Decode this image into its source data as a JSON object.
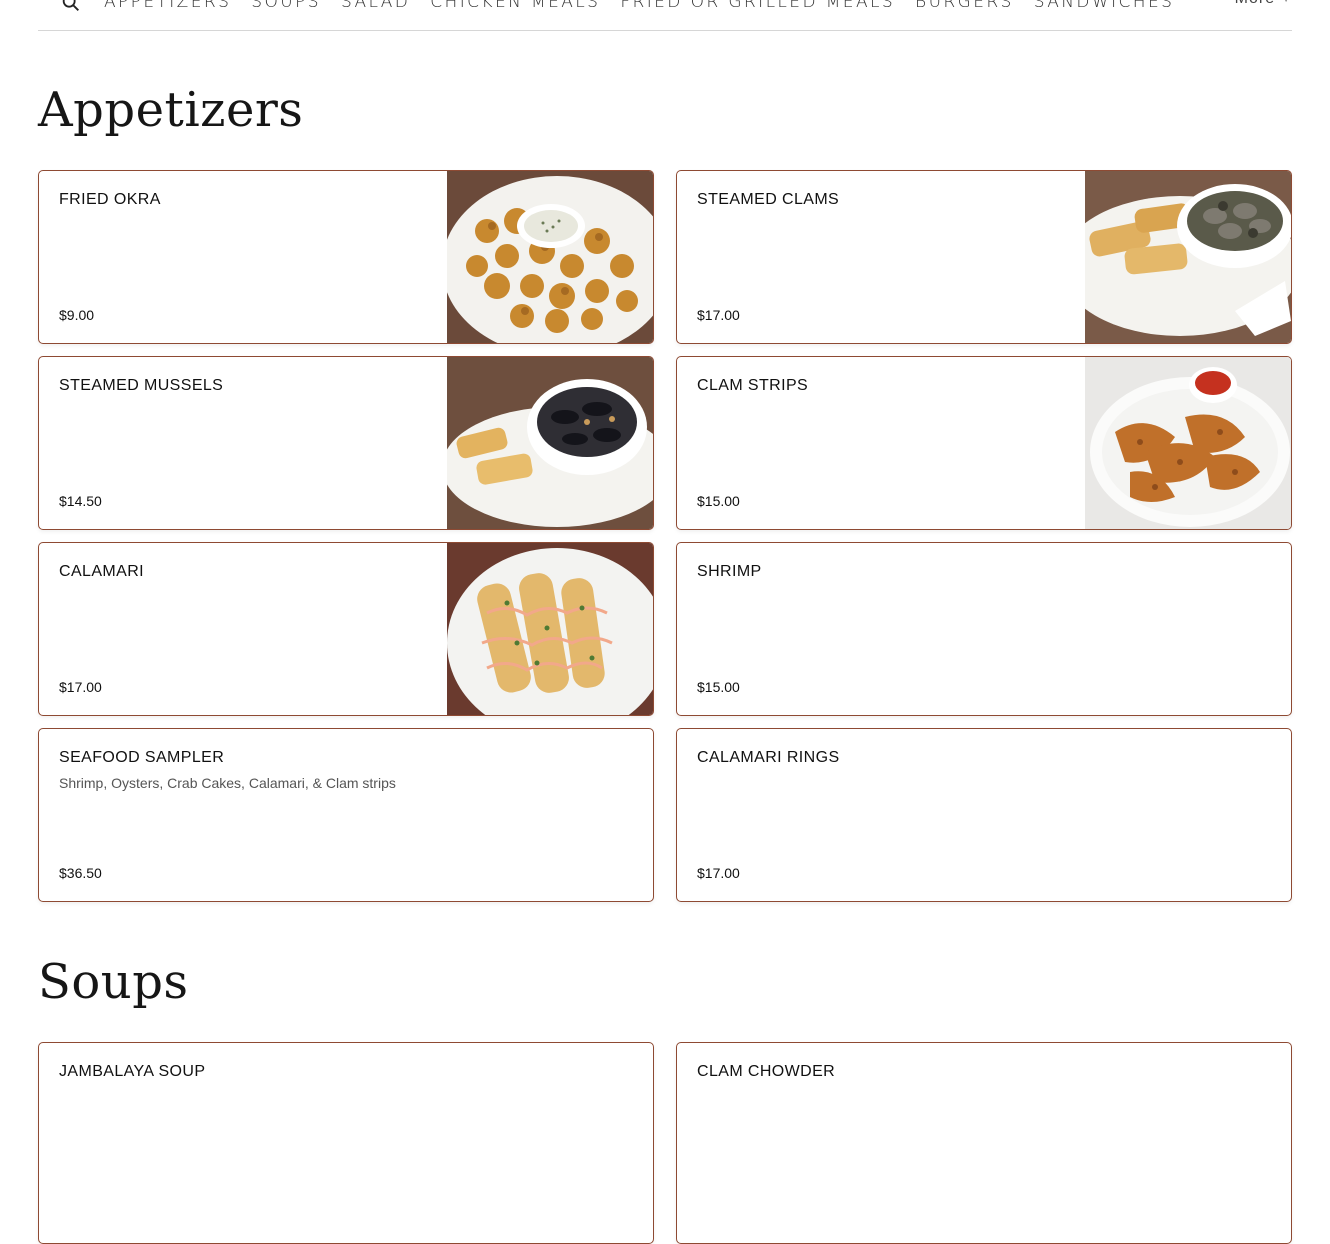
{
  "nav": {
    "items": [
      "Appetizers",
      "Soups",
      "Salad",
      "Chicken Meals",
      "Fried or Grilled Meals",
      "Burgers",
      "Sandwiches"
    ],
    "more_label": "More"
  },
  "sections": [
    {
      "title": "Appetizers",
      "items": [
        {
          "name": "FRIED OKRA",
          "price": "$9.00",
          "photo": "fried-okra-photo"
        },
        {
          "name": "STEAMED CLAMS",
          "price": "$17.00",
          "photo": "steamed-clams-photo"
        },
        {
          "name": "STEAMED MUSSELS",
          "price": "$14.50",
          "photo": "steamed-mussels-photo"
        },
        {
          "name": "CLAM STRIPS",
          "price": "$15.00",
          "photo": "clam-strips-photo"
        },
        {
          "name": "CALAMARI",
          "price": "$17.00",
          "photo": "calamari-photo"
        },
        {
          "name": "SHRIMP",
          "price": "$15.00"
        },
        {
          "name": "SEAFOOD SAMPLER",
          "description": "Shrimp, Oysters, Crab Cakes, Calamari, & Clam strips",
          "price": "$36.50"
        },
        {
          "name": "CALAMARI RINGS",
          "price": "$17.00"
        }
      ]
    },
    {
      "title": "Soups",
      "items": [
        {
          "name": "JAMBALAYA SOUP"
        },
        {
          "name": "CLAM CHOWDER"
        }
      ]
    }
  ],
  "colors": {
    "card_border": "#8e4a33",
    "text": "#1a1a1a"
  }
}
